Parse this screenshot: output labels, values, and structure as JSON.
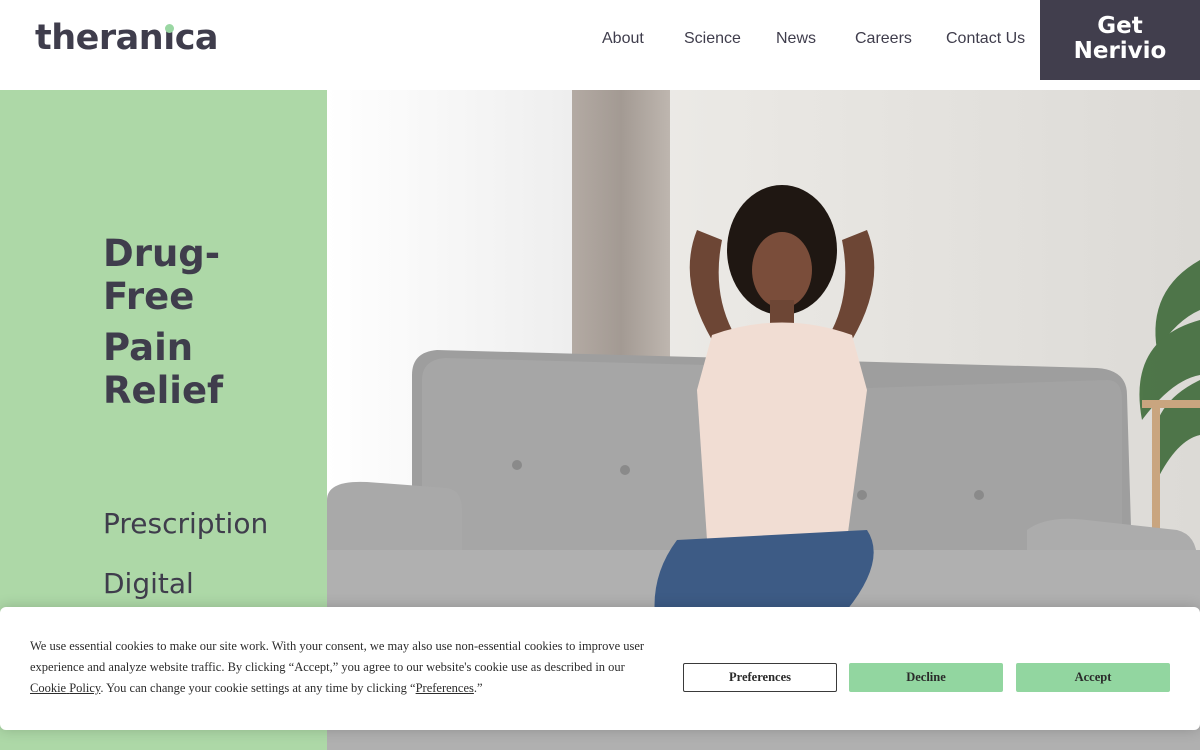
{
  "header": {
    "logo_prefix": "theran",
    "logo_i": "ı",
    "logo_suffix": "ca",
    "nav": [
      "About",
      "Science",
      "News",
      "Careers",
      "Contact Us"
    ],
    "cta_line1": "Get",
    "cta_line2": "Nerivio"
  },
  "hero": {
    "headline_1a": "Drug-",
    "headline_1b": "Free",
    "headline_2a": "Pain",
    "headline_2b": "Relief",
    "sub_1": "Prescription",
    "sub_2": "Digital"
  },
  "cookie": {
    "text_1": "We use essential cookies to make our site work. With your consent, we may also use non-essential cookies to improve user experience and analyze website traffic. By clicking “Accept,” you agree to our website's cookie use as described in our ",
    "link_policy_a": "Cookie",
    "link_policy_b": "Policy",
    "text_2": ". You can change your cookie settings at any time by clicking “",
    "link_prefs": "Preferences",
    "text_3": ".”",
    "btn_preferences": "Preferences",
    "btn_decline": "Decline",
    "btn_accept": "Accept"
  },
  "colors": {
    "brand_dark": "#413e4d",
    "brand_green": "#add8a7",
    "button_green": "#92d6a0"
  }
}
